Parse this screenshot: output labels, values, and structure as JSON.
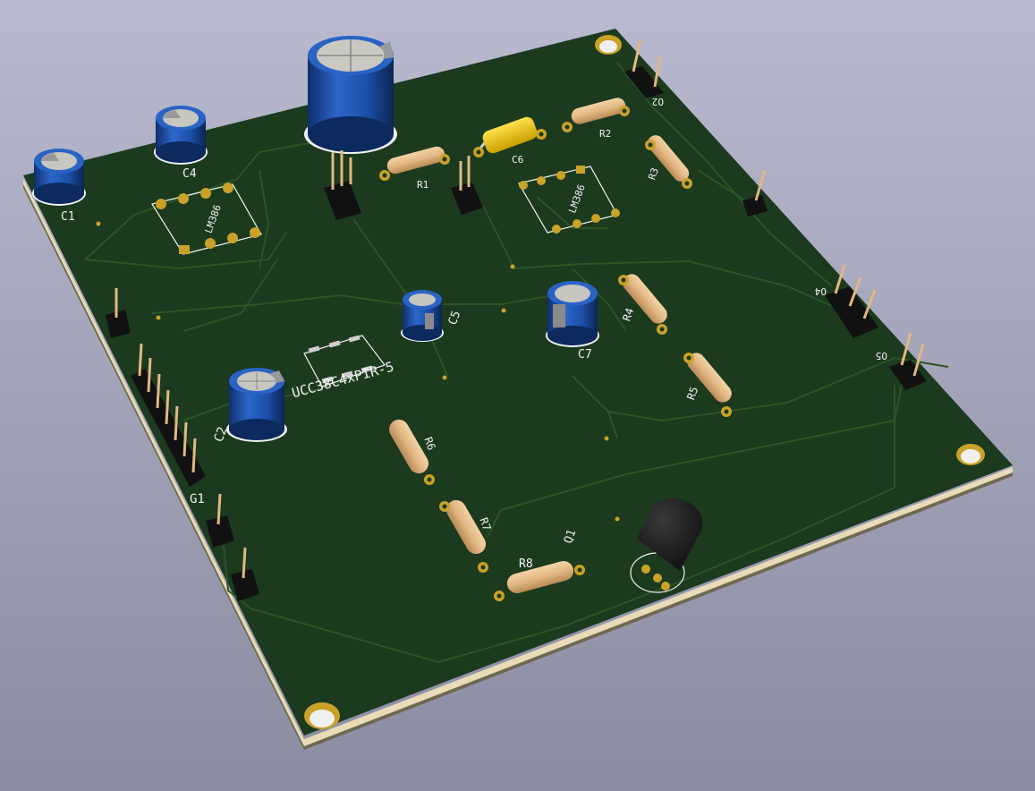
{
  "scene": {
    "background_top": "#b9bad0",
    "background_bottom": "#8b8ca2",
    "board_color": "#1b3a1e",
    "board_edge_color": "#e8dcb8",
    "trace_color": "#2d5526",
    "silkscreen_color": "#f2f2f2",
    "pad_color": "#c9a227"
  },
  "labels": {
    "c1": "C1",
    "c2": "C2",
    "c4": "C4",
    "c5": "C5",
    "c6": "C6",
    "c7": "C7",
    "r1": "R1",
    "r2": "R2",
    "r3": "R3",
    "r4": "R4",
    "r5": "R5",
    "r6": "R6",
    "r7": "R7",
    "r8": "R8",
    "q1": "Q1",
    "g1": "G1",
    "o2": "O2",
    "o4": "O4",
    "o5": "O5",
    "ic_left": "LM386",
    "ic_right": "LM386",
    "ic_center": "UCC38C4xPIR-5"
  },
  "components": {
    "capacitors": [
      "C1",
      "C2",
      "C4",
      "C5",
      "C6",
      "C7"
    ],
    "resistors": [
      "R1",
      "R2",
      "R3",
      "R4",
      "R5",
      "R6",
      "R7",
      "R8"
    ],
    "transistors": [
      "Q1"
    ],
    "headers": [
      "G1",
      "O2",
      "O4",
      "O5"
    ],
    "ics": [
      "LM386",
      "LM386",
      "UCC38C4xPIR-5"
    ]
  }
}
